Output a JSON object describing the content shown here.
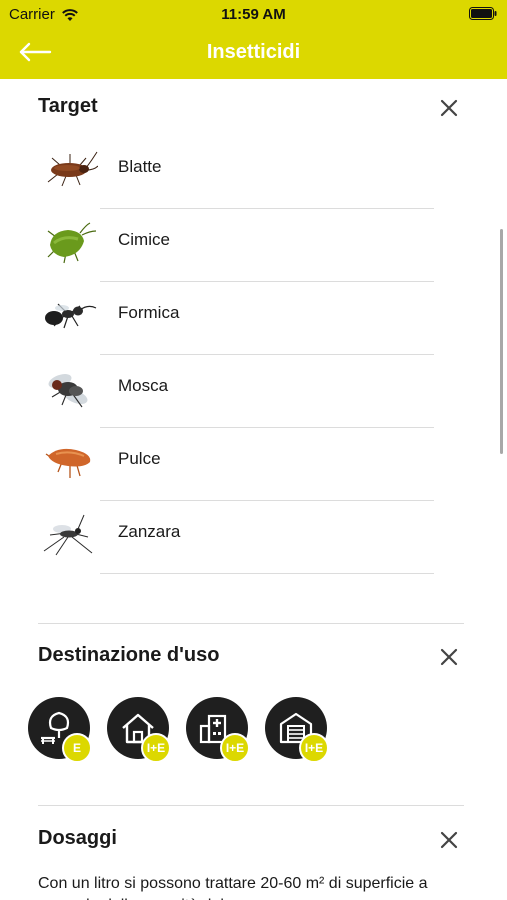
{
  "status": {
    "carrier": "Carrier",
    "time": "11:59 AM"
  },
  "nav": {
    "title": "Insetticidi"
  },
  "target": {
    "title": "Target",
    "items": [
      {
        "label": "Blatte",
        "icon": "cockroach-icon"
      },
      {
        "label": "Cimice",
        "icon": "stink-bug-icon"
      },
      {
        "label": "Formica",
        "icon": "ant-icon"
      },
      {
        "label": "Mosca",
        "icon": "fly-icon"
      },
      {
        "label": "Pulce",
        "icon": "flea-icon"
      },
      {
        "label": "Zanzara",
        "icon": "mosquito-icon"
      }
    ]
  },
  "destinazione": {
    "title": "Destinazione d'uso",
    "items": [
      {
        "icon": "outdoor-tree-bench-icon",
        "badge": "E"
      },
      {
        "icon": "house-icon",
        "badge": "I+E"
      },
      {
        "icon": "hospital-icon",
        "badge": "I+E"
      },
      {
        "icon": "garage-icon",
        "badge": "I+E"
      }
    ]
  },
  "dosaggi": {
    "title": "Dosaggi",
    "text": "Con un litro si possono trattare 20-60 m² di superficie a seconda della porosità del"
  },
  "colors": {
    "accent": "#dcd800",
    "icon_bg": "#1f1f1f",
    "text": "#1a1a1a"
  }
}
